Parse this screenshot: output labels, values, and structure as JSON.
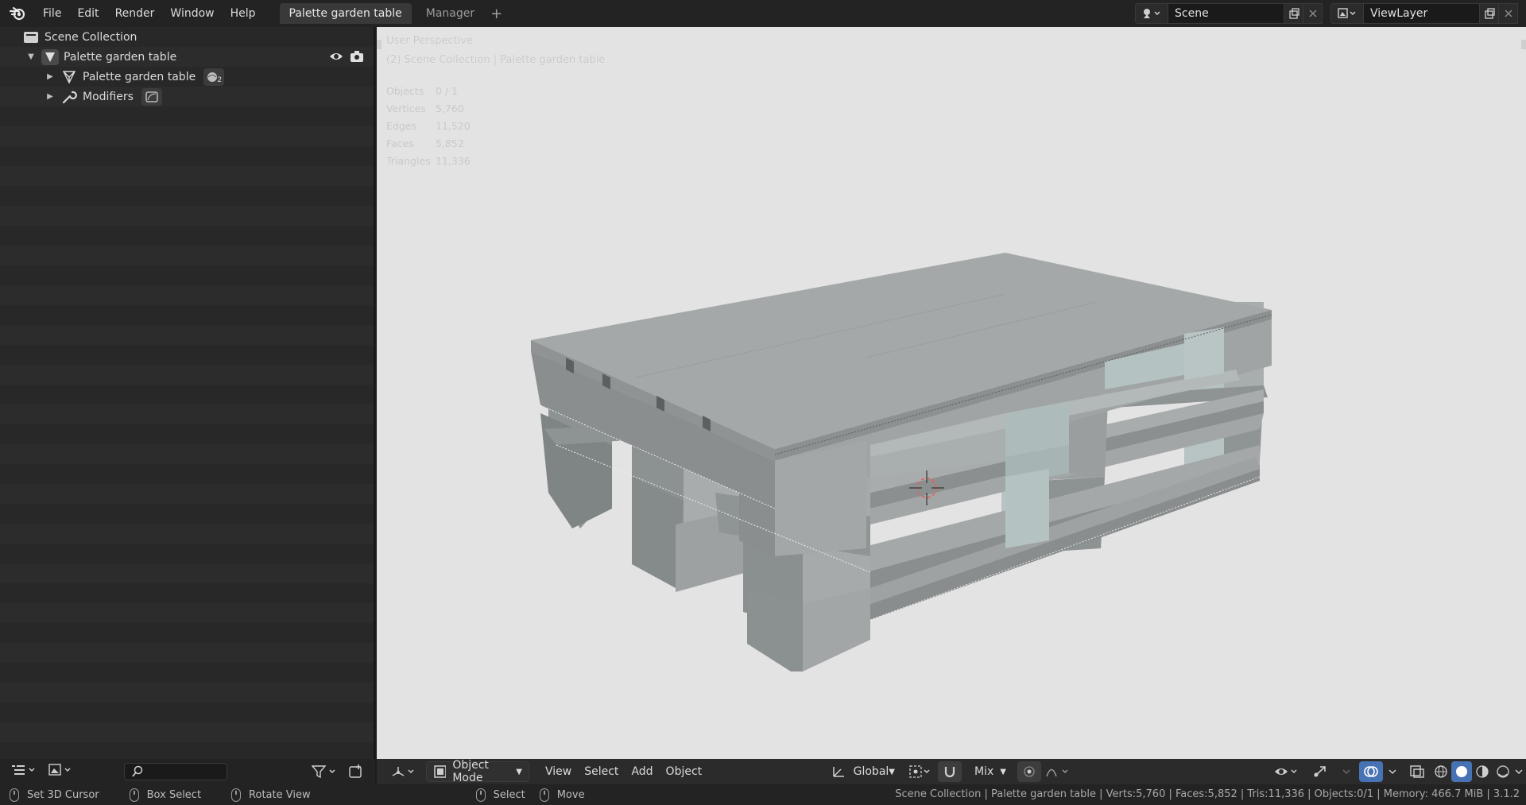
{
  "topbar": {
    "menu": [
      "File",
      "Edit",
      "Render",
      "Window",
      "Help"
    ],
    "workspace_tabs": [
      "Palette garden table",
      "Manager"
    ],
    "scene_name": "Scene",
    "view_layer_name": "ViewLayer"
  },
  "outliner": {
    "rows": [
      {
        "label": "Scene Collection"
      },
      {
        "label": "Palette garden table"
      },
      {
        "label": "Palette garden table",
        "badge": "2"
      },
      {
        "label": "Modifiers"
      }
    ],
    "search_placeholder": ""
  },
  "viewport": {
    "perspective": "User Perspective",
    "collection_path": "(2) Scene Collection | Palette garden table",
    "stats": [
      {
        "label": "Objects",
        "value": "0 / 1"
      },
      {
        "label": "Vertices",
        "value": "5,760"
      },
      {
        "label": "Edges",
        "value": "11,520"
      },
      {
        "label": "Faces",
        "value": "5,852"
      },
      {
        "label": "Triangles",
        "value": "11,336"
      }
    ]
  },
  "viewport_header": {
    "mode": "Object Mode",
    "menus": [
      "View",
      "Select",
      "Add",
      "Object"
    ],
    "orientation": "Global",
    "snap_mode": "Mix"
  },
  "statusbar": {
    "hints": [
      "Set 3D Cursor",
      "Box Select",
      "Rotate View",
      "Select",
      "Move"
    ],
    "info": "Scene Collection | Palette garden table | Verts:5,760 | Faces:5,852 | Tris:11,336 | Objects:0/1 | Memory: 466.7 MiB | 3.1.2"
  },
  "colors": {
    "accent": "#4772b3",
    "viewport_bg": "#e3e3e3",
    "model": "#9a9a9a"
  }
}
